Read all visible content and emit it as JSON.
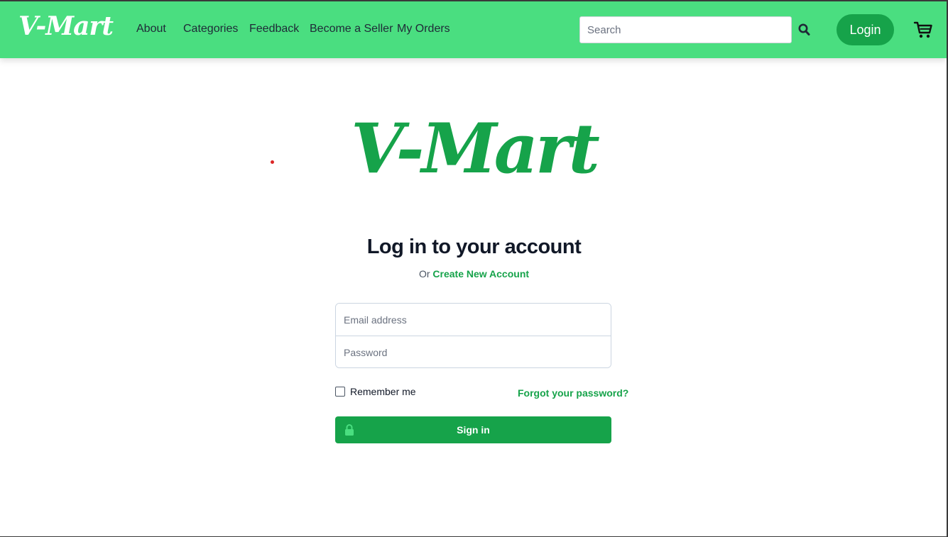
{
  "navbar": {
    "brand": "V-Mart",
    "links": [
      "About",
      "Categories",
      "Feedback",
      "Become a Seller",
      "My Orders"
    ],
    "search_placeholder": "Search",
    "login_label": "Login"
  },
  "main": {
    "logo": "V-Mart",
    "heading": "Log in to your account",
    "or_text": "Or",
    "create_account": "Create New Account",
    "email_placeholder": "Email address",
    "password_placeholder": "Password",
    "remember_label": "Remember me",
    "forgot_label": "Forgot your password?",
    "signin_label": "Sign in"
  },
  "colors": {
    "navbar_bg": "#4ade80",
    "accent": "#16a34a"
  },
  "icons": [
    "search-icon",
    "cart-icon",
    "lock-icon"
  ]
}
